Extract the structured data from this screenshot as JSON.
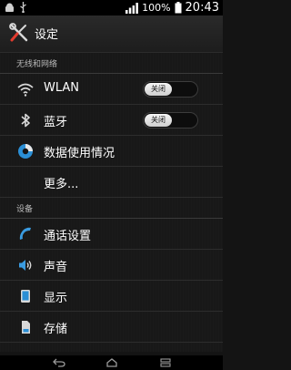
{
  "status": {
    "battery_percent": "100%",
    "time": "20:43"
  },
  "app": {
    "title": "设定"
  },
  "sections": {
    "wireless": "无线和网络",
    "device": "设备"
  },
  "items": [
    {
      "label": "WLAN",
      "toggle": "关闭"
    },
    {
      "label": "蓝牙",
      "toggle": "关闭"
    },
    {
      "label": "数据使用情况"
    },
    {
      "label": "更多..."
    },
    {
      "label": "通话设置"
    },
    {
      "label": "声音"
    },
    {
      "label": "显示"
    },
    {
      "label": "存储"
    }
  ],
  "icons": [
    "settings-tools-icon",
    "wifi-icon",
    "bluetooth-icon",
    "data-usage-icon",
    "phone-icon",
    "speaker-icon",
    "display-icon",
    "storage-icon"
  ],
  "colors": {
    "accent": "#2b8fd6",
    "background": "#141414"
  }
}
